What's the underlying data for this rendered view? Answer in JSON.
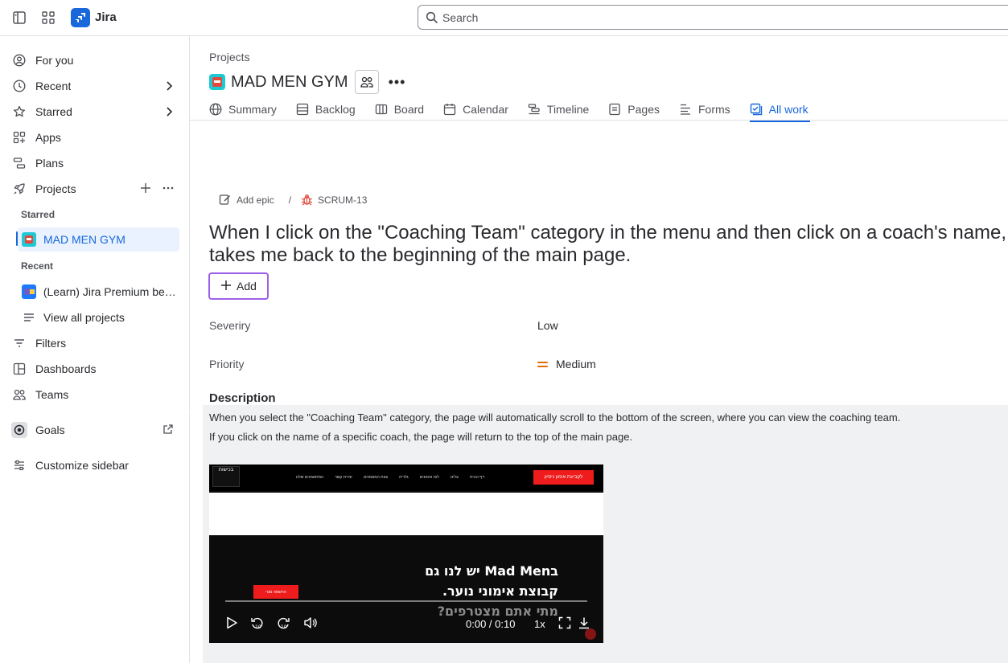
{
  "topbar": {
    "app_name": "Jira",
    "search_placeholder": "Search"
  },
  "sidebar": {
    "for_you": "For you",
    "recent": "Recent",
    "starred": "Starred",
    "apps": "Apps",
    "plans": "Plans",
    "projects": "Projects",
    "starred_section": "Starred",
    "starred_project": "MAD MEN GYM",
    "recent_section": "Recent",
    "recent_project": "(Learn) Jira Premium ben...",
    "view_all_projects": "View all projects",
    "filters": "Filters",
    "dashboards": "Dashboards",
    "teams": "Teams",
    "goals": "Goals",
    "customize": "Customize sidebar"
  },
  "project": {
    "breadcrumb": "Projects",
    "title": "MAD MEN GYM",
    "more": "•••"
  },
  "tabs": [
    {
      "label": "Summary"
    },
    {
      "label": "Backlog"
    },
    {
      "label": "Board"
    },
    {
      "label": "Calendar"
    },
    {
      "label": "Timeline"
    },
    {
      "label": "Pages"
    },
    {
      "label": "Forms"
    },
    {
      "label": "All work"
    }
  ],
  "issue": {
    "add_epic": "Add epic",
    "separator": "/",
    "key": "SCRUM-13",
    "title_line1": "When I click on the \"Coaching Team\" category in the menu and then click on a coach's name, it",
    "title_line2": "takes me back to the beginning of the main page.",
    "add_label": "Add",
    "severity_label": "Severiry",
    "severity_value": "Low",
    "priority_label": "Priority",
    "priority_value": "Medium",
    "description_heading": "Description",
    "description_line1": "When you select the \"Coaching Team\" category, the page will automatically scroll to the bottom of the screen, where you can view the coaching team.",
    "description_line2": "If you click on the name of a specific coach, the page will return to the top of the main page."
  },
  "video": {
    "logo": "בכישות",
    "menu": [
      "המתאמנים שלנו",
      "יצירת קשר",
      "צוות המאמנים",
      "גלריה",
      "לוח אימונים",
      "עלינו",
      "דף הבית"
    ],
    "cta": "לקביעת אימון ניסיון",
    "hero_line1": "בMad Men יש לנו גם",
    "hero_line2": "קבוצת אימוני נוער.",
    "hero_line3": "מתי אתם מצטרפים?",
    "hero_button": "הרשמה מנוי",
    "time": "0:00 / 0:10",
    "speed": "1x"
  },
  "colors": {
    "accent": "#1868db",
    "add_button_border": "#9f60e9",
    "priority": "#e06c00",
    "cta_red": "#ee1c1c"
  }
}
